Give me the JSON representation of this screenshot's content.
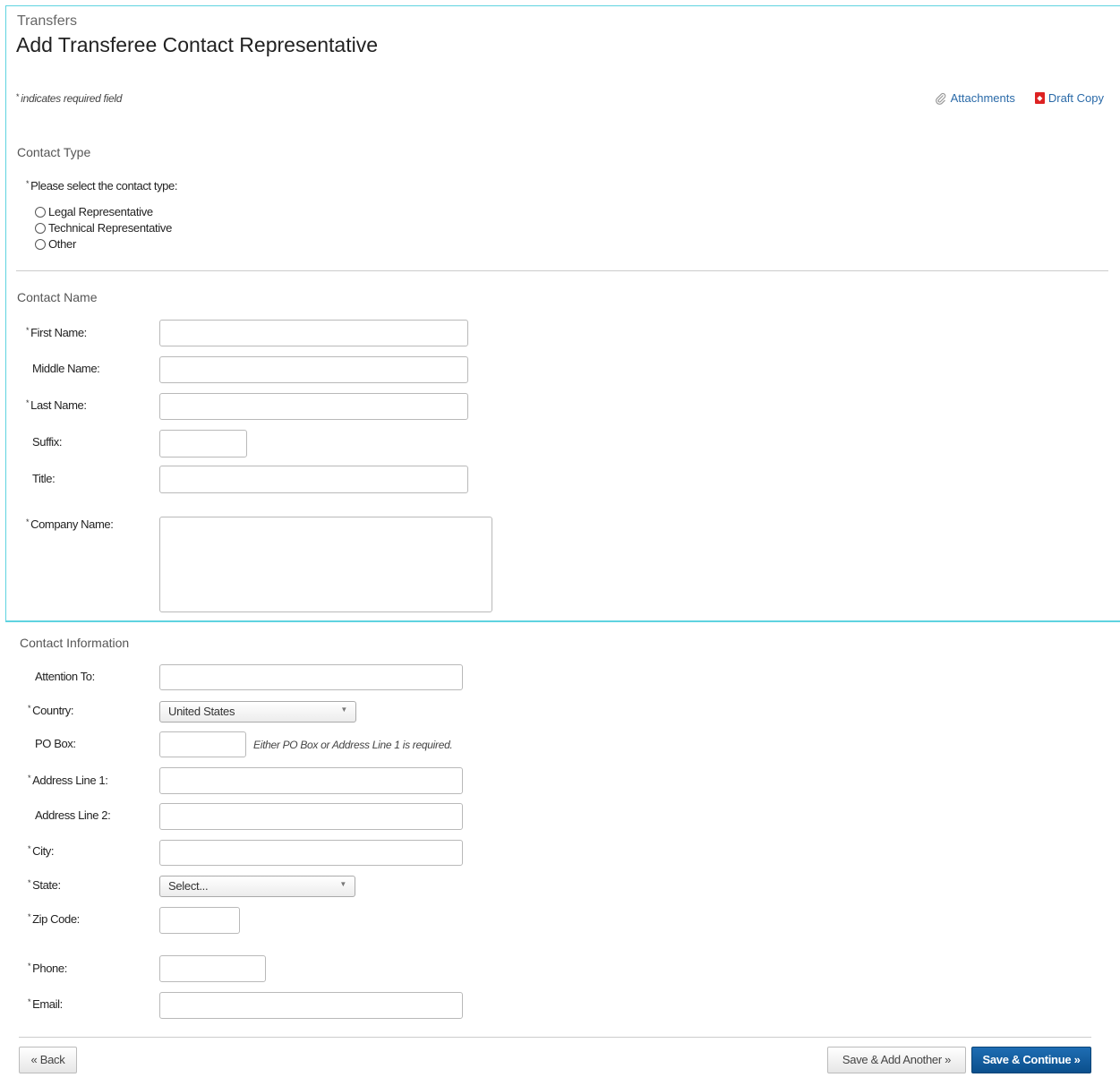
{
  "breadcrumb": "Transfers",
  "page_title": "Add Transferee Contact Representative",
  "required_note": "indicates required field",
  "required_marker": "*",
  "links": {
    "attachments": "Attachments",
    "draft_copy": "Draft Copy"
  },
  "contact_type": {
    "section_title": "Contact Type",
    "prompt": "Please select the contact type:",
    "options": [
      "Legal Representative",
      "Technical Representative",
      "Other"
    ]
  },
  "contact_name": {
    "section_title": "Contact Name",
    "first_name": "First Name:",
    "middle_name": "Middle Name:",
    "last_name": "Last Name:",
    "suffix": "Suffix:",
    "title": "Title:",
    "company_name": "Company Name:"
  },
  "contact_info": {
    "section_title": "Contact Information",
    "attention_to": "Attention To:",
    "country": "Country:",
    "country_value": "United States",
    "po_box": "PO Box:",
    "po_box_hint": "Either PO Box or Address Line 1 is required.",
    "address1": "Address Line 1:",
    "address2": "Address Line 2:",
    "city": "City:",
    "state": "State:",
    "state_value": "Select...",
    "zip": "Zip Code:",
    "phone": "Phone:",
    "email": "Email:"
  },
  "buttons": {
    "back": "« Back",
    "save_add": "Save & Add Another »",
    "save_continue": "Save & Continue »"
  },
  "icons": {
    "attachments": "paperclip-icon",
    "draft_copy": "pdf-icon",
    "dropdown": "chevron-down-icon"
  },
  "colors": {
    "accent_border": "#5fd3e0",
    "link": "#2a6aa8",
    "primary_button": "#0b4f8c"
  }
}
